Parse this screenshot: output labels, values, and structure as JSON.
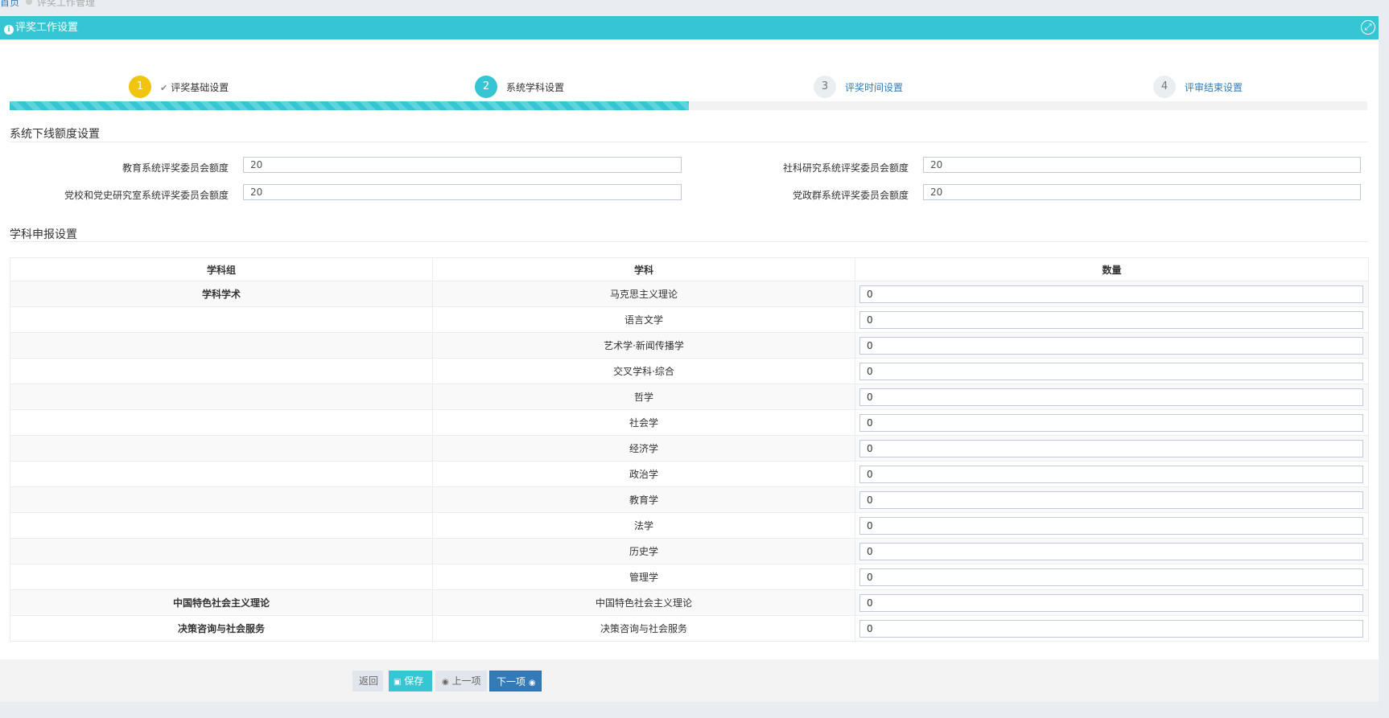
{
  "breadcrumb": {
    "home": "首页",
    "current": "评奖工作管理"
  },
  "panel": {
    "title": "评奖工作设置",
    "expand_icon": "expand-icon"
  },
  "steps": [
    {
      "num": "1",
      "label": "评奖基础设置",
      "state": "done"
    },
    {
      "num": "2",
      "label": "系统学科设置",
      "state": "active"
    },
    {
      "num": "3",
      "label": "评奖时间设置",
      "state": "todo"
    },
    {
      "num": "4",
      "label": "评审结束设置",
      "state": "todo"
    }
  ],
  "progress": {
    "percent": 50
  },
  "quota": {
    "title": "系统下线额度设置",
    "fields": [
      {
        "label": "教育系统评奖委员会额度",
        "value": "20"
      },
      {
        "label": "社科研究系统评奖委员会额度",
        "value": "20"
      },
      {
        "label": "党校和党史研究室系统评奖委员会额度",
        "value": "20"
      },
      {
        "label": "党政群系统评奖委员会额度",
        "value": "20"
      }
    ]
  },
  "subjects": {
    "title": "学科申报设置",
    "headers": [
      "学科组",
      "学科",
      "数量"
    ],
    "rows": [
      {
        "group": "学科学术",
        "subject": "马克思主义理论",
        "qty": "0"
      },
      {
        "group": "",
        "subject": "语言文学",
        "qty": "0"
      },
      {
        "group": "",
        "subject": "艺术学·新闻传播学",
        "qty": "0"
      },
      {
        "group": "",
        "subject": "交叉学科·综合",
        "qty": "0"
      },
      {
        "group": "",
        "subject": "哲学",
        "qty": "0"
      },
      {
        "group": "",
        "subject": "社会学",
        "qty": "0"
      },
      {
        "group": "",
        "subject": "经济学",
        "qty": "0"
      },
      {
        "group": "",
        "subject": "政治学",
        "qty": "0"
      },
      {
        "group": "",
        "subject": "教育学",
        "qty": "0"
      },
      {
        "group": "",
        "subject": "法学",
        "qty": "0"
      },
      {
        "group": "",
        "subject": "历史学",
        "qty": "0"
      },
      {
        "group": "",
        "subject": "管理学",
        "qty": "0"
      },
      {
        "group": "中国特色社会主义理论",
        "subject": "中国特色社会主义理论",
        "qty": "0"
      },
      {
        "group": "决策咨询与社会服务",
        "subject": "决策咨询与社会服务",
        "qty": "0"
      }
    ]
  },
  "footer": {
    "back": "返回",
    "save": "保存",
    "prev": "上一项",
    "next": "下一项"
  },
  "colors": {
    "accent": "#36c6d3",
    "done": "#f1c40f",
    "primary": "#337ab7"
  }
}
